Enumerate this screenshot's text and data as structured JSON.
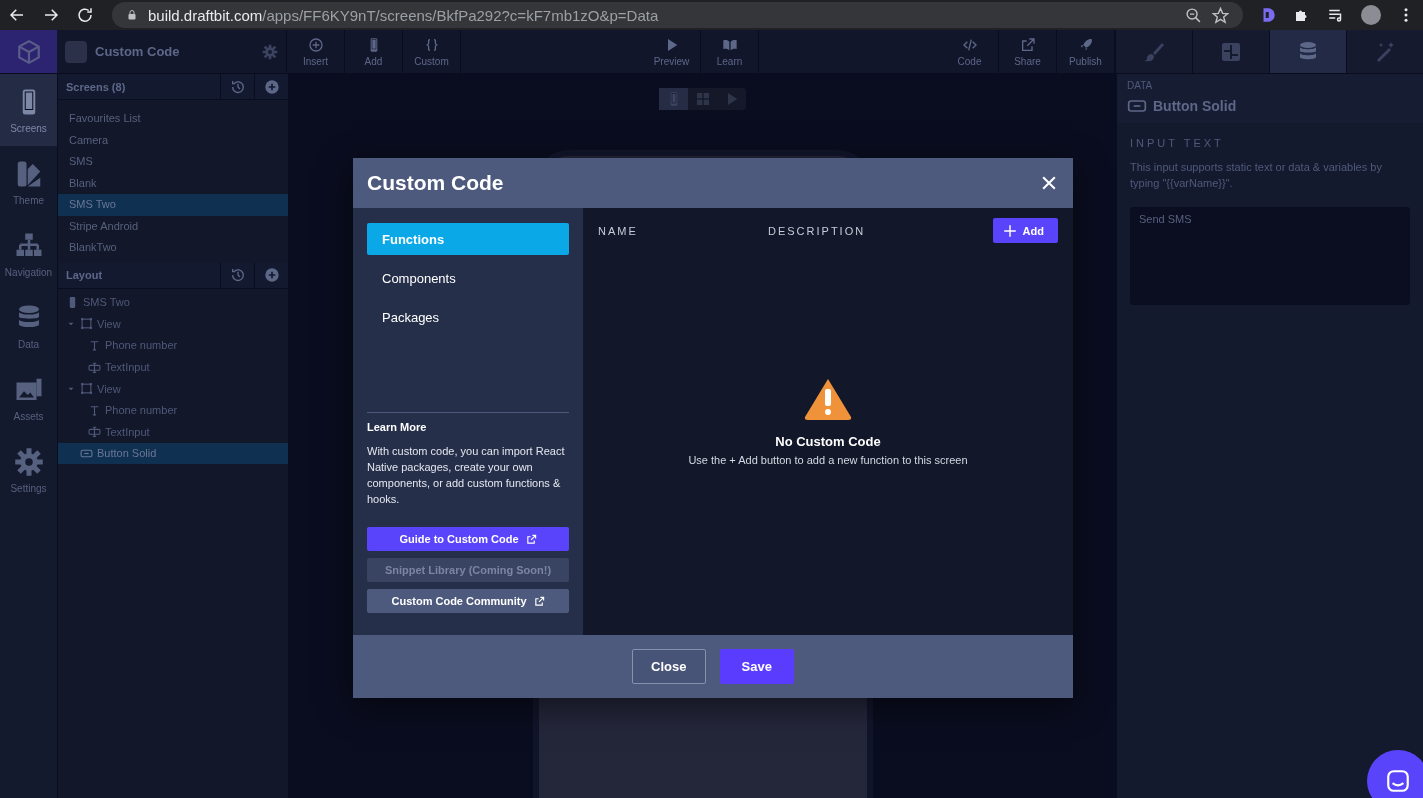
{
  "browser": {
    "url_host": "build.draftbit.com",
    "url_path": "/apps/FF6KY9nT/screens/BkfPa292?c=kF7mb1zO&p=Data"
  },
  "topbar": {
    "project_title": "Custom Code",
    "tools": [
      {
        "label": "Insert"
      },
      {
        "label": "Add"
      },
      {
        "label": "Custom"
      }
    ],
    "center_tools": [
      {
        "label": "Preview"
      },
      {
        "label": "Learn"
      }
    ],
    "right_tools": [
      {
        "label": "Code"
      },
      {
        "label": "Share"
      },
      {
        "label": "Publish"
      }
    ],
    "panel_tabs": [
      {
        "selected": false
      },
      {
        "selected": false
      },
      {
        "selected": true
      },
      {
        "selected": false
      }
    ]
  },
  "rail": [
    {
      "label": "Screens",
      "selected": true
    },
    {
      "label": "Theme",
      "selected": false
    },
    {
      "label": "Navigation",
      "selected": false
    },
    {
      "label": "Data",
      "selected": false
    },
    {
      "label": "Assets",
      "selected": false
    },
    {
      "label": "Settings",
      "selected": false
    }
  ],
  "screens": {
    "title": "Screens (8)",
    "items": [
      {
        "label": "Favourites List",
        "selected": false
      },
      {
        "label": "Camera",
        "selected": false
      },
      {
        "label": "SMS",
        "selected": false
      },
      {
        "label": "Blank",
        "selected": false
      },
      {
        "label": "SMS Two",
        "selected": true
      },
      {
        "label": "Stripe Android",
        "selected": false
      },
      {
        "label": "BlankTwo",
        "selected": false
      }
    ]
  },
  "layout": {
    "title": "Layout",
    "tree": [
      {
        "label": "SMS Two",
        "kind": "screen",
        "selected": false
      },
      {
        "label": "View",
        "kind": "view",
        "selected": false,
        "expanded": true,
        "children": [
          {
            "label": "Phone number",
            "kind": "text",
            "selected": false
          },
          {
            "label": "TextInput",
            "kind": "input",
            "selected": false
          }
        ]
      },
      {
        "label": "View",
        "kind": "view",
        "selected": false,
        "expanded": true,
        "children": [
          {
            "label": "Phone number",
            "kind": "text",
            "selected": false
          },
          {
            "label": "TextInput",
            "kind": "input",
            "selected": false
          }
        ]
      },
      {
        "label": "Button Solid",
        "kind": "button",
        "selected": true
      }
    ]
  },
  "canvas": {
    "view_modes": [
      {
        "selected": true
      },
      {
        "selected": false
      },
      {
        "selected": false
      }
    ]
  },
  "inspector": {
    "section": "DATA",
    "component": "Button Solid",
    "field_label": "INPUT TEXT",
    "help": "This input supports static text or data & variables by typing \"{{varName}}\".",
    "value": "Send SMS"
  },
  "modal": {
    "title": "Custom Code",
    "nav": [
      {
        "label": "Functions",
        "selected": true
      },
      {
        "label": "Components",
        "selected": false
      },
      {
        "label": "Packages",
        "selected": false
      }
    ],
    "learn_title": "Learn More",
    "learn_text": "With custom code, you can import React Native packages, create your own components, or add custom functions & hooks.",
    "links": [
      {
        "label": "Guide to Custom Code",
        "kind": "primary",
        "external": true
      },
      {
        "label": "Snippet Library (Coming Soon!)",
        "kind": "disabled",
        "external": false
      },
      {
        "label": "Custom Code Community",
        "kind": "secondary",
        "external": true
      }
    ],
    "columns": [
      "NAME",
      "DESCRIPTION"
    ],
    "add_label": "Add",
    "empty_title": "No Custom Code",
    "empty_text": "Use the + Add button to add a new function to this screen",
    "footer": [
      {
        "label": "Close",
        "kind": "secondary"
      },
      {
        "label": "Save",
        "kind": "primary"
      }
    ]
  }
}
